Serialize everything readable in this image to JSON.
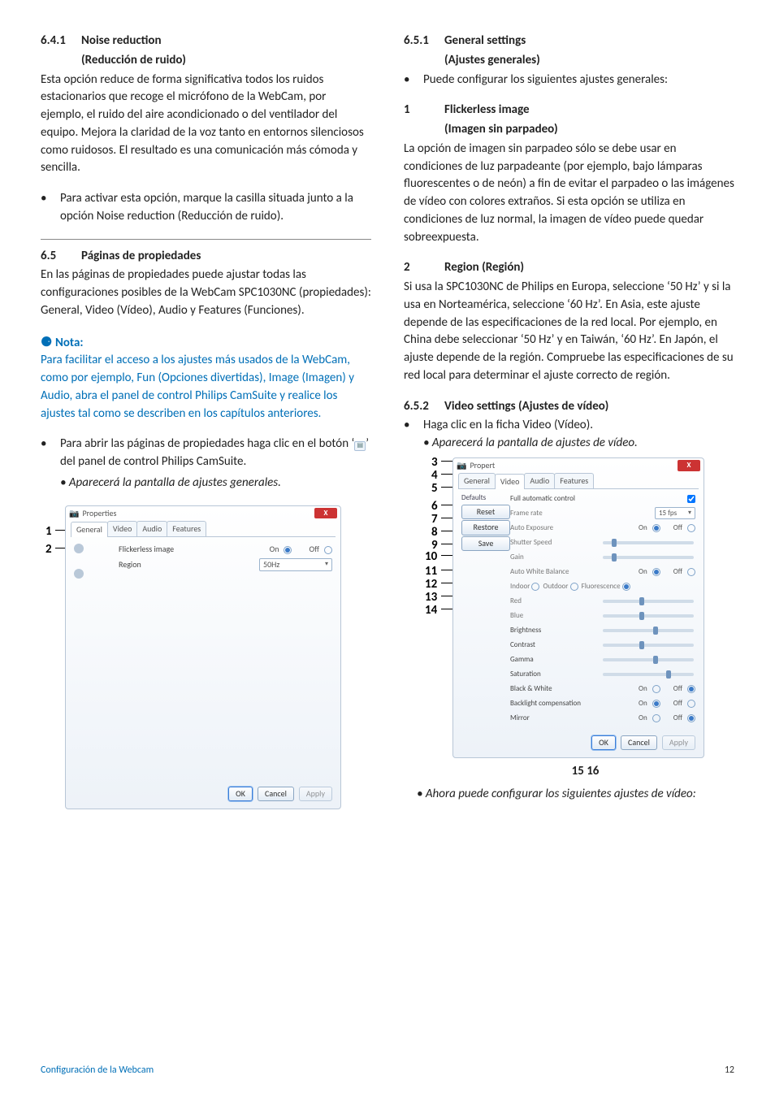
{
  "left": {
    "h641_num": "6.4.1",
    "h641_title": "Noise reduction",
    "h641_sub": "(Reducción de ruido)",
    "p641": "Esta opción reduce de forma significativa todos los ruidos estacionarios que recoge el micrófono de la WebCam, por ejemplo, el ruido del aire acondicionado o del ventilador del equipo. Mejora la claridad de la voz tanto en entornos silenciosos como ruidosos. El resultado es una comunicación más cómoda y sencilla.",
    "b641": "Para activar esta opción, marque la casilla situada junto a la opción Noise reduction (Reducción de ruido).",
    "h65_num": "6.5",
    "h65_title": "Páginas de propiedades",
    "p65": "En las páginas de propiedades puede ajustar todas las configuraciones posibles de la WebCam SPC1030NC (propiedades): General, Video (Vídeo), Audio y Features (Funciones).",
    "note_title": "Nota:",
    "note_body": "Para facilitar el acceso a los ajustes más usados de la WebCam, como por ejemplo, Fun (Opciones divertidas), Image (Imagen) y Audio, abra el panel de control Philips CamSuite y realice los ajustes tal como se describen en los capítulos anteriores.",
    "open_pages": "Para abrir las páginas de propiedades haga clic en el botón ‘",
    "open_pages2": "’ del panel de control Philips CamSuite.",
    "open_result": "• Aparecerá la pantalla de ajustes generales.",
    "dlg1": {
      "title": "Properties",
      "tabs": [
        "General",
        "Video",
        "Audio",
        "Features"
      ],
      "row1_label": "Flickerless image",
      "row1_on": "On",
      "row1_off": "Off",
      "row2_label": "Region",
      "row2_value": "50Hz",
      "ok": "OK",
      "cancel": "Cancel",
      "apply": "Apply"
    },
    "m1": "1",
    "m2": "2"
  },
  "right": {
    "h651_num": "6.5.1",
    "h651_title": "General settings",
    "h651_sub": "(Ajustes generales)",
    "b651": "Puede configurar los siguientes ajustes generales:",
    "h1_num": "1",
    "h1_title": "Flickerless image",
    "h1_sub": "(Imagen sin parpadeo)",
    "p1": "La opción de imagen sin parpadeo sólo se debe usar en condiciones de luz parpadeante (por ejemplo, bajo lámparas fluorescentes o de neón) a fin de evitar el parpadeo o las imágenes de vídeo con colores extraños. Si esta opción se utiliza en condiciones de luz normal, la imagen de vídeo puede quedar sobreexpuesta.",
    "h2_num": "2",
    "h2_title": "Region (Región)",
    "p2": "Si usa la SPC1030NC de Philips en Europa, seleccione ‘50 Hz’ y si la usa en Norteamérica, seleccione ‘60 Hz’. En Asia, este ajuste depende de las especificaciones de la red local. Por ejemplo, en China debe seleccionar ‘50 Hz’ y en Taiwán, ‘60 Hz’. En Japón, el ajuste depende de la región. Compruebe las especificaciones de su red local para determinar el ajuste correcto de región.",
    "h652_num": "6.5.2",
    "h652_title": "Video settings (Ajustes de vídeo)",
    "b652": "Haga clic en la ficha Video (Vídeo).",
    "b652_res": "• Aparecerá la pantalla de ajustes de vídeo.",
    "after": "• Ahora puede configurar los siguientes ajustes de vídeo:",
    "dlg2": {
      "title": "Propert",
      "tabs": [
        "General",
        "Video",
        "Audio",
        "Features"
      ],
      "defaults": "Defaults",
      "reset": "Reset",
      "restore": "Restore",
      "save": "Save",
      "fac": "Full automatic control",
      "fr": "Frame rate",
      "fr_v": "15 fps",
      "ae": "Auto Exposure",
      "on": "On",
      "off": "Off",
      "ss": "Shutter Speed",
      "gain": "Gain",
      "awb": "Auto White Balance",
      "indoor": "Indoor",
      "outdoor": "Outdoor",
      "fluor": "Fluorescence",
      "red": "Red",
      "blue": "Blue",
      "bright": "Brightness",
      "contrast": "Contrast",
      "gamma": "Gamma",
      "sat": "Saturation",
      "bw": "Black & White",
      "bc": "Backlight compensation",
      "mirror": "Mirror",
      "ok": "OK",
      "cancel": "Cancel",
      "apply": "Apply"
    },
    "m": [
      "3",
      "4",
      "5",
      "6",
      "7",
      "8",
      "9",
      "10",
      "11",
      "12",
      "13",
      "14"
    ],
    "bottom": "15 16"
  },
  "footer": {
    "left": "Configuración de la Webcam",
    "page": "12"
  }
}
